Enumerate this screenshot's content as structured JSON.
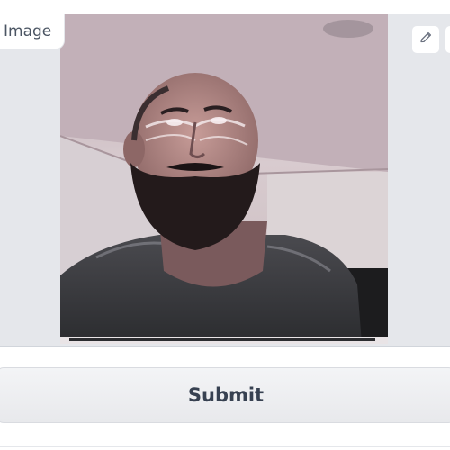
{
  "image_panel": {
    "label": "Image",
    "photo_description_icon": "portrait-photo"
  },
  "toolbar": {
    "edit_icon": "pencil-icon"
  },
  "actions": {
    "submit_label": "Submit"
  },
  "colors": {
    "panel_bg": "#e5e7eb",
    "button_text": "#374151",
    "label_text": "#4b5563"
  }
}
